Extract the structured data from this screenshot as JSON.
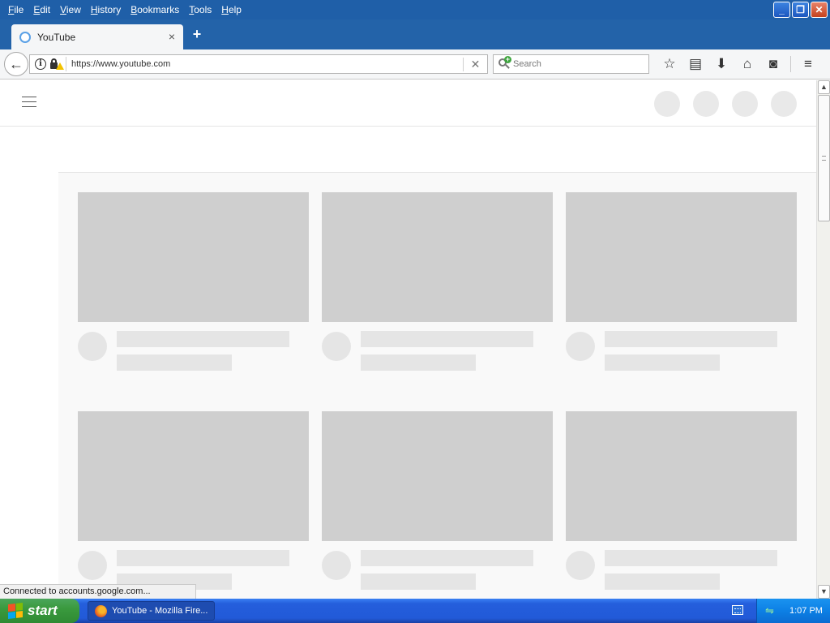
{
  "menubar": {
    "items": [
      {
        "label": "File",
        "accel": "F",
        "rest": "ile"
      },
      {
        "label": "Edit",
        "accel": "E",
        "rest": "dit"
      },
      {
        "label": "View",
        "accel": "V",
        "rest": "iew"
      },
      {
        "label": "History",
        "accel": "H",
        "rest": "istory"
      },
      {
        "label": "Bookmarks",
        "accel": "B",
        "rest": "ookmarks"
      },
      {
        "label": "Tools",
        "accel": "T",
        "rest": "ools"
      },
      {
        "label": "Help",
        "accel": "H",
        "rest": "elp"
      }
    ]
  },
  "window_controls": {
    "minimize": "_",
    "restore": "❐",
    "close": "✕"
  },
  "tab": {
    "title": "YouTube",
    "close": "×"
  },
  "new_tab": "+",
  "navbar": {
    "back": "←",
    "info": "i",
    "url": "https://www.youtube.com",
    "clear": "✕",
    "search_placeholder": "Search"
  },
  "toolbar_icons": [
    "star-icon",
    "reading-list-icon",
    "download-icon",
    "home-icon",
    "pocket-icon",
    "menu-icon"
  ],
  "toolbar_glyphs": {
    "star": "☆",
    "reading_list": "▤",
    "download": "⬇",
    "home": "⌂",
    "pocket": "◙",
    "menu": "≡"
  },
  "youtube": {
    "top_circles": 4,
    "cards": 6
  },
  "scrollbar": {
    "up": "▲",
    "down": "▼"
  },
  "status_text": "Connected to accounts.google.com...",
  "taskbar": {
    "start_label": "start",
    "task_label": "YouTube - Mozilla Fire...",
    "clock": "1:07 PM"
  },
  "colors": {
    "titlebar": "#1f5fa8",
    "placeholder_dark": "#cfcfcf",
    "placeholder_light": "#e5e5e5",
    "start_green": "#3a9a3e"
  }
}
